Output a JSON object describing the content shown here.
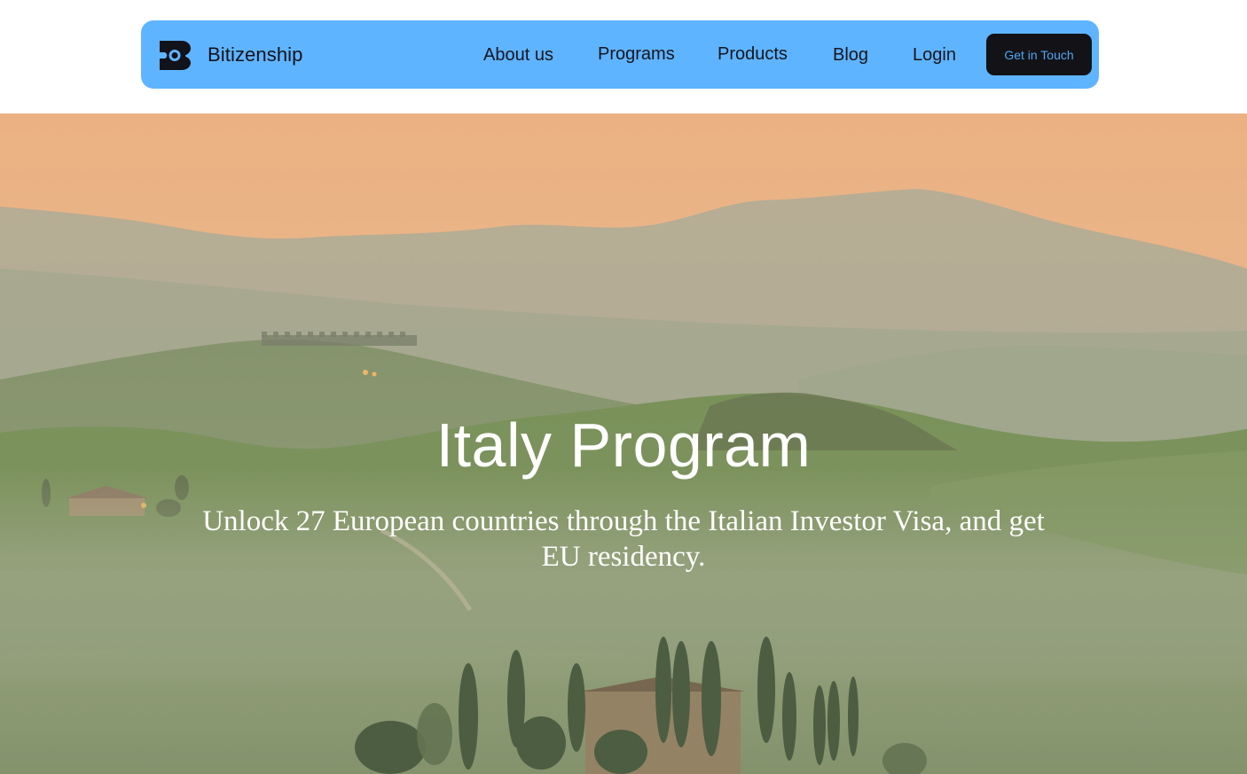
{
  "header": {
    "brand_name": "Bitizenship",
    "logo_icon": "bitizenship-logo-icon",
    "nav": {
      "about": "About us",
      "programs": "Programs",
      "products": "Products",
      "blog": "Blog",
      "login": "Login"
    },
    "cta_label": "Get in Touch"
  },
  "hero": {
    "title": "Italy Program",
    "subtitle": "Unlock 27 European countries through the Italian Investor Visa, and get EU residency."
  },
  "colors": {
    "nav_background": "#5fb4ff",
    "cta_background": "#131317",
    "cta_text": "#4fa6f3",
    "hero_text": "#ffffff"
  }
}
